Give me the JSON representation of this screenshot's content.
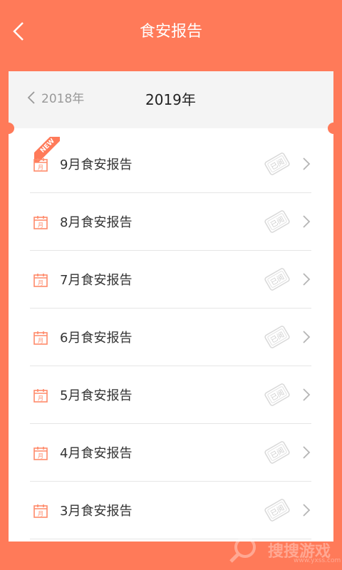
{
  "header": {
    "title": "食安报告",
    "back_icon": "chevron-left-icon"
  },
  "year_selector": {
    "prev_year": "2018年",
    "current_year": "2019年"
  },
  "reports": [
    {
      "label": "9月食安报告",
      "badge": "NEW",
      "status_stamp": "已阅"
    },
    {
      "label": "8月食安报告",
      "status_stamp": "已阅"
    },
    {
      "label": "7月食安报告",
      "status_stamp": "已阅"
    },
    {
      "label": "6月食安报告",
      "status_stamp": "已阅"
    },
    {
      "label": "5月食安报告",
      "status_stamp": "已阅"
    },
    {
      "label": "4月食安报告",
      "status_stamp": "已阅"
    },
    {
      "label": "3月食安报告",
      "status_stamp": "已阅"
    }
  ],
  "calendar_icon_text": "月",
  "watermark": {
    "text": "搜搜游戏",
    "sub": "www.yxss.com"
  },
  "colors": {
    "accent": "#FF7A59",
    "card_bg": "#FFFFFF",
    "header_bg": "#F4F4F4"
  }
}
